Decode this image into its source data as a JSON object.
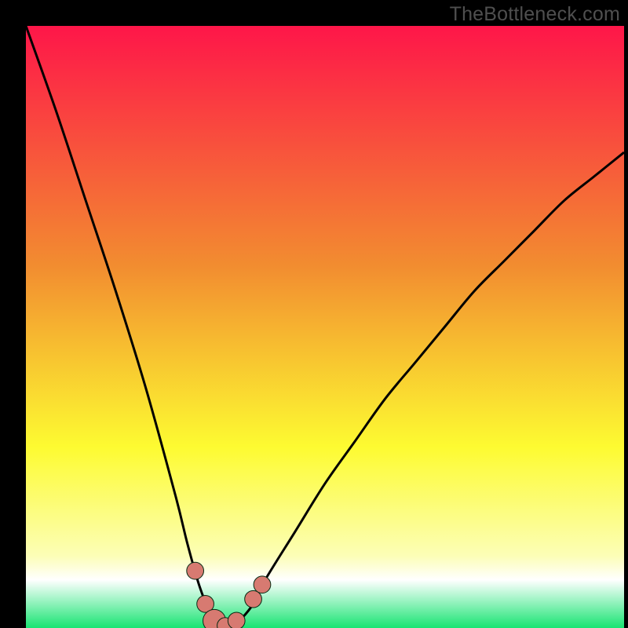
{
  "watermark": "TheBottleneck.com",
  "colors": {
    "red": "#fe1649",
    "orange": "#f28d30",
    "yellow": "#fdfb31",
    "paleyellow": "#fcfeb6",
    "white": "#ffffff",
    "green": "#18e472",
    "curve": "#000000",
    "marker_fill": "#d77a71",
    "marker_stroke": "#062b13"
  },
  "chart_data": {
    "type": "line",
    "title": "",
    "xlabel": "",
    "ylabel": "",
    "xlim": [
      0,
      100
    ],
    "ylim": [
      0,
      100
    ],
    "grid": false,
    "legend": false,
    "series": [
      {
        "name": "bottleneck-curve",
        "x": [
          0,
          5,
          10,
          15,
          20,
          25,
          27,
          29,
          31,
          32,
          33,
          34,
          35,
          36,
          38,
          40,
          45,
          50,
          55,
          60,
          65,
          70,
          75,
          80,
          85,
          90,
          95,
          100
        ],
        "y": [
          100,
          86,
          71,
          56,
          40,
          22,
          14,
          7,
          2,
          0.7,
          0.3,
          0.3,
          0.7,
          1.5,
          4,
          8,
          16,
          24,
          31,
          38,
          44,
          50,
          56,
          61,
          66,
          71,
          75,
          79
        ]
      }
    ],
    "markers": [
      {
        "name": "dot-left-upper",
        "x": 28.3,
        "y": 9.5,
        "r": 1.5
      },
      {
        "name": "dot-left-lower",
        "x": 30.0,
        "y": 4.0,
        "r": 1.5
      },
      {
        "name": "dot-bottom",
        "x": 31.5,
        "y": 1.2,
        "r": 2.0
      },
      {
        "name": "dot-center",
        "x": 33.3,
        "y": 0.4,
        "r": 1.4
      },
      {
        "name": "dot-right-lower",
        "x": 35.2,
        "y": 1.2,
        "r": 1.5
      },
      {
        "name": "dot-right-upper",
        "x": 38.0,
        "y": 4.8,
        "r": 1.5
      },
      {
        "name": "dot-right-top",
        "x": 39.5,
        "y": 7.2,
        "r": 1.5
      }
    ],
    "annotations": []
  }
}
